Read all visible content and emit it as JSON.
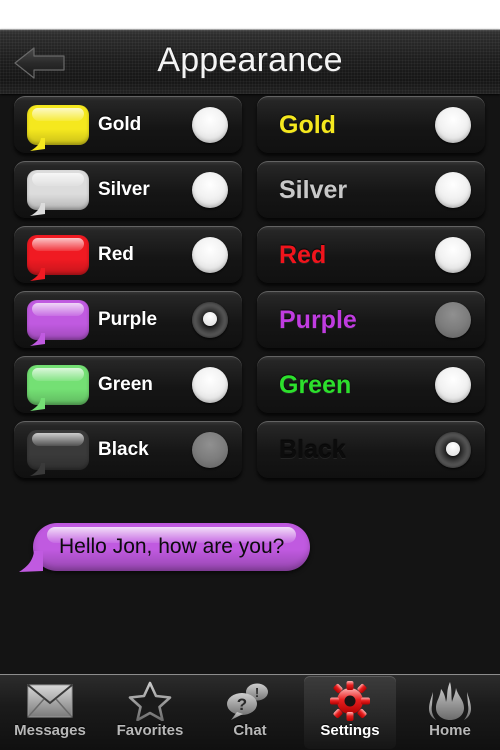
{
  "header": {
    "title": "Appearance",
    "back_icon": "back-arrow-icon"
  },
  "colors": {
    "gold": "#f5e81e",
    "silver": "#dcdcdc",
    "red": "#f01a22",
    "purple": "#c05ae0",
    "green": "#74e074",
    "black": "#3a3a3a",
    "background": "#141414",
    "accent_red": "#e01010"
  },
  "bubble_color_section": {
    "name": "bubble-color-list",
    "rows": [
      {
        "label": "Gold",
        "swatch": "#f5e81e",
        "selected": false,
        "dim": false
      },
      {
        "label": "Silver",
        "swatch": "#dcdcdc",
        "selected": false,
        "dim": false
      },
      {
        "label": "Red",
        "swatch": "#f01a22",
        "selected": false,
        "dim": false
      },
      {
        "label": "Purple",
        "swatch": "#c05ae0",
        "selected": true,
        "dim": false
      },
      {
        "label": "Green",
        "swatch": "#74e074",
        "selected": false,
        "dim": false
      },
      {
        "label": "Black",
        "swatch": "#3a3a3a",
        "selected": false,
        "dim": true
      }
    ]
  },
  "text_color_section": {
    "name": "text-color-list",
    "rows": [
      {
        "label": "Gold",
        "text_color": "#f5e81e",
        "selected": false,
        "dim": false
      },
      {
        "label": "Silver",
        "text_color": "#c8c8c8",
        "selected": false,
        "dim": false
      },
      {
        "label": "Red",
        "text_color": "#f0141c",
        "selected": false,
        "dim": false
      },
      {
        "label": "Purple",
        "text_color": "#c03ce0",
        "selected": false,
        "dim": true
      },
      {
        "label": "Green",
        "text_color": "#2ce02c",
        "selected": false,
        "dim": false
      },
      {
        "label": "Black",
        "text_color": "#0c0c0c",
        "selected": true,
        "dim": false
      }
    ]
  },
  "preview": {
    "message": "Hello Jon, how are you?",
    "bubble_color": "#c05ae0",
    "text_color": "#0c0c0c"
  },
  "tabbar": {
    "tabs": [
      {
        "label": "Messages",
        "icon": "envelope-icon",
        "active": false
      },
      {
        "label": "Favorites",
        "icon": "star-icon",
        "active": false
      },
      {
        "label": "Chat",
        "icon": "speech-bubbles-icon",
        "active": false
      },
      {
        "label": "Settings",
        "icon": "gear-icon",
        "active": true
      },
      {
        "label": "Home",
        "icon": "flame-icon",
        "active": false
      }
    ]
  }
}
